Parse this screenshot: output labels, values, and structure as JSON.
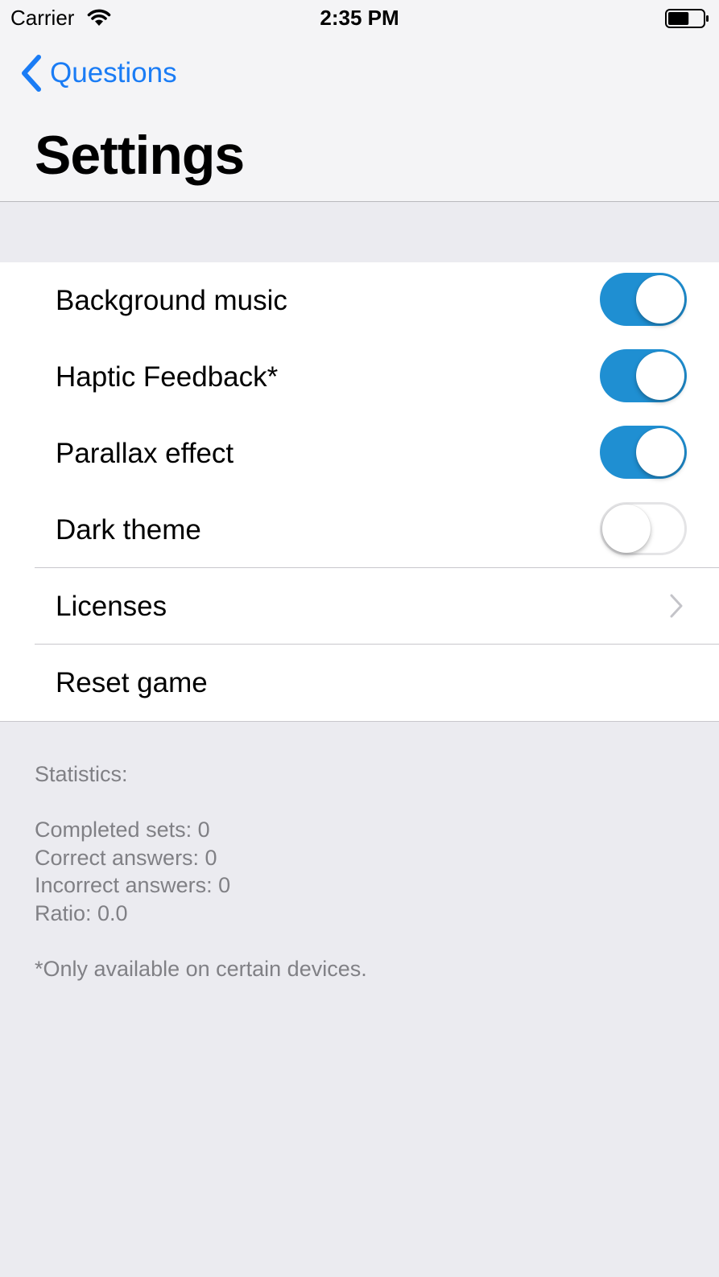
{
  "status_bar": {
    "carrier": "Carrier",
    "time": "2:35 PM",
    "battery_level": 0.6
  },
  "nav": {
    "back_label": "Questions",
    "title": "Settings",
    "accent_color": "#1a7cf5"
  },
  "settings": {
    "background_music": {
      "label": "Background music",
      "on": true
    },
    "haptic_feedback": {
      "label": "Haptic Feedback*",
      "on": true
    },
    "parallax_effect": {
      "label": "Parallax effect",
      "on": true
    },
    "dark_theme": {
      "label": "Dark theme",
      "on": false
    },
    "licenses": {
      "label": "Licenses"
    },
    "reset_game": {
      "label": "Reset game"
    },
    "switch_on_color": "#1f8fd2"
  },
  "footer": {
    "statistics_heading": "Statistics:",
    "completed_sets": "Completed sets: 0",
    "correct_answers": "Correct answers: 0",
    "incorrect_answers": "Incorrect answers: 0",
    "ratio": "Ratio: 0.0",
    "note": "*Only available on certain devices."
  }
}
